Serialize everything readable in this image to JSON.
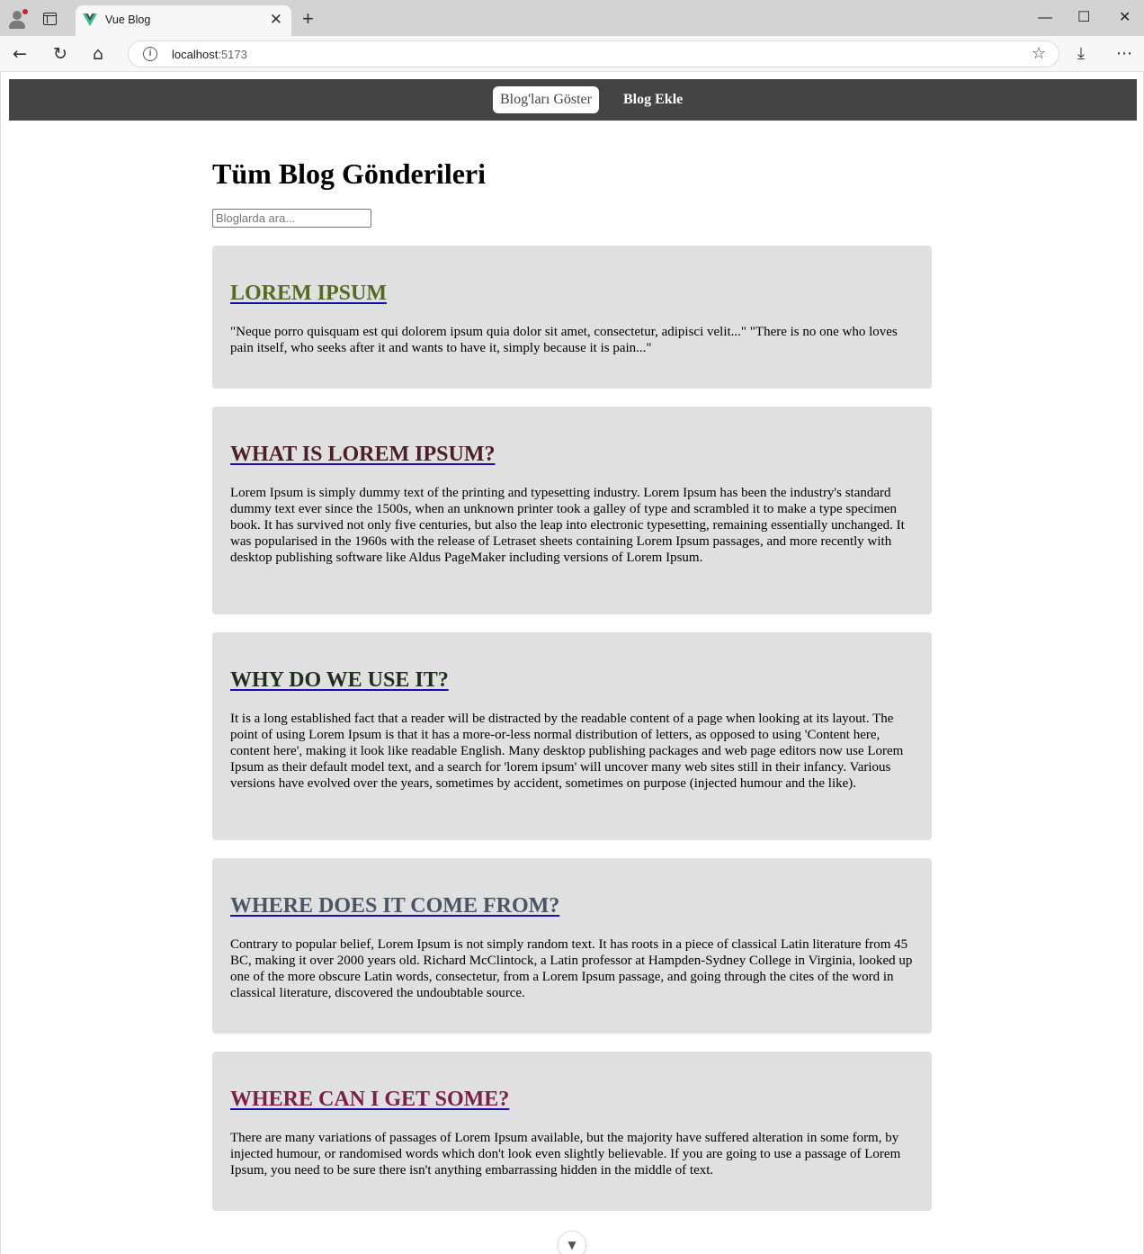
{
  "browser": {
    "tab_title": "Vue Blog",
    "tab_close": "✕",
    "new_tab": "+",
    "url_host": "localhost",
    "url_port": ":5173",
    "window_controls": {
      "minimize": "—",
      "maximize": "☐",
      "close": "✕"
    }
  },
  "nav": {
    "items": [
      {
        "label": "Blog'ları Göster",
        "active": true
      },
      {
        "label": "Blog Ekle",
        "active": false
      }
    ]
  },
  "page": {
    "title": "Tüm Blog Gönderileri",
    "search_placeholder": "Bloglarda ara..."
  },
  "blogs": [
    {
      "title": "Lorem ipsum",
      "title_color": "#556b1f",
      "body": "\"Neque porro quisquam est qui dolorem ipsum quia dolor sit amet, consectetur, adipisci velit...\" \"There is no one who loves pain itself, who seeks after it and wants to have it, simply because it is pain...\""
    },
    {
      "title": "What is Lorem Ipsum?",
      "title_color": "#4a1f2a",
      "body": "Lorem Ipsum is simply dummy text of the printing and typesetting industry. Lorem Ipsum has been the industry's standard dummy text ever since the 1500s, when an unknown printer took a galley of type and scrambled it to make a type specimen book. It has survived not only five centuries, but also the leap into electronic typesetting, remaining essentially unchanged. It was popularised in the 1960s with the release of Letraset sheets containing Lorem Ipsum passages, and more recently with desktop publishing software like Aldus PageMaker including versions of Lorem Ipsum."
    },
    {
      "title": "Why do we use it?",
      "title_color": "#1f2e1f",
      "body": "It is a long established fact that a reader will be distracted by the readable content of a page when looking at its layout. The point of using Lorem Ipsum is that it has a more-or-less normal distribution of letters, as opposed to using 'Content here, content here', making it look like readable English. Many desktop publishing packages and web page editors now use Lorem Ipsum as their default model text, and a search for 'lorem ipsum' will uncover many web sites still in their infancy. Various versions have evolved over the years, sometimes by accident, sometimes on purpose (injected humour and the like)."
    },
    {
      "title": "Where does it come from?",
      "title_color": "#4a5566",
      "body": "Contrary to popular belief, Lorem Ipsum is not simply random text. It has roots in a piece of classical Latin literature from 45 BC, making it over 2000 years old. Richard McClintock, a Latin professor at Hampden-Sydney College in Virginia, looked up one of the more obscure Latin words, consectetur, from a Lorem Ipsum passage, and going through the cites of the word in classical literature, discovered the undoubtable source."
    },
    {
      "title": "Where can I get some?",
      "title_color": "#7a1f45",
      "body": "There are many variations of passages of Lorem Ipsum available, but the majority have suffered alteration in some form, by injected humour, or randomised words which don't look even slightly believable. If you are going to use a passage of Lorem Ipsum, you need to be sure there isn't anything embarrassing hidden in the middle of text."
    }
  ]
}
